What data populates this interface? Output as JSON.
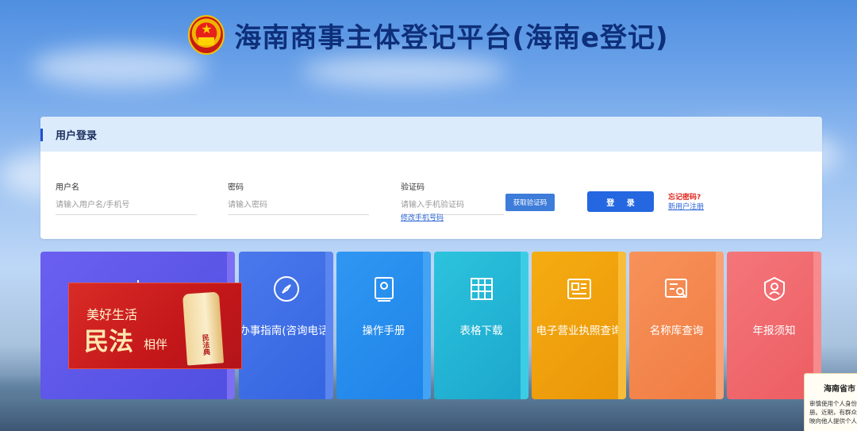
{
  "header": {
    "title": "海南商事主体登记平台(海南e登记)"
  },
  "login": {
    "section_title": "用户登录",
    "username_label": "用户名",
    "username_placeholder": "请输入用户名/手机号",
    "password_label": "密码",
    "password_placeholder": "请输入密码",
    "captcha_label": "验证码",
    "captcha_placeholder": "请输入手机验证码",
    "get_code_button": "获取验证码",
    "change_phone_link": "修改手机号码",
    "login_button": "登 录",
    "forgot_link": "忘记密码?",
    "register_link": "新用户注册"
  },
  "tiles": [
    {
      "label": "办事指南(咨询电话)",
      "icon": "compass-icon"
    },
    {
      "label": "操作手册",
      "icon": "manual-book-icon"
    },
    {
      "label": "表格下载",
      "icon": "table-grid-icon"
    },
    {
      "label": "电子营业执照查询",
      "icon": "license-document-icon"
    },
    {
      "label": "名称库查询",
      "icon": "name-search-icon"
    },
    {
      "label": "年报须知",
      "icon": "shield-user-icon"
    }
  ],
  "banner": {
    "line1": "美好生活",
    "line2": "民法",
    "line3": "相伴",
    "book_text": "民法典"
  },
  "notice": {
    "title": "海南省市",
    "text": "审慎使用个人身份注册。近期，有群众反映向他人提供个人"
  },
  "colors": {
    "tile1": "#5b57ea",
    "tile2": "#3f6fe6",
    "tile3": "#2a8ff0",
    "tile4": "#23b7d8",
    "tile5": "#f2a40f",
    "tile6": "#f5894f",
    "tile7": "#f0696c",
    "accent": "#2467e0"
  }
}
